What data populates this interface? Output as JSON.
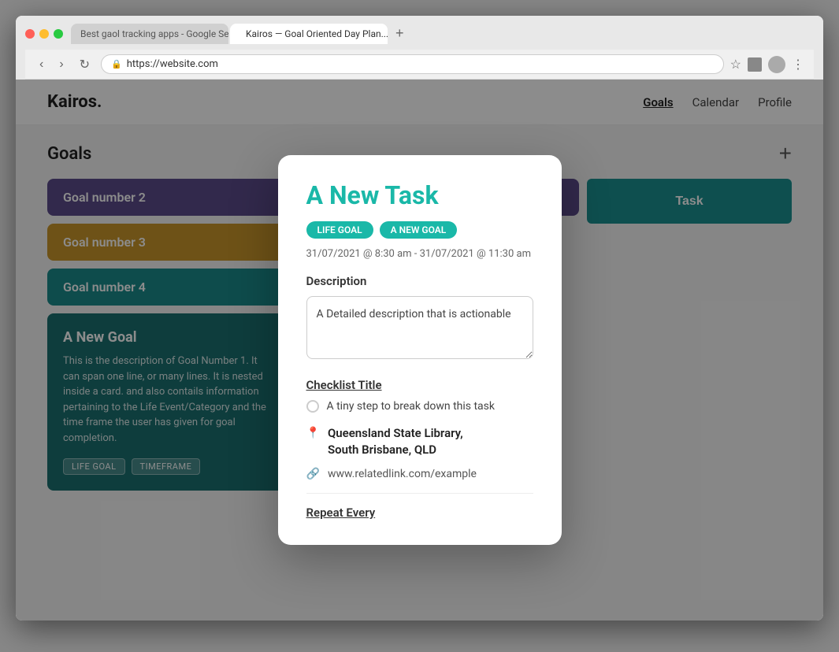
{
  "browser": {
    "tabs": [
      {
        "label": "Best gaol tracking apps - Google Sear...",
        "active": false
      },
      {
        "label": "Kairos — Goal Oriented Day Plan...",
        "active": true
      }
    ],
    "new_tab_label": "+",
    "url": "https://website.com"
  },
  "app": {
    "logo": "Kairos.",
    "nav": {
      "links": [
        {
          "label": "Goals",
          "active": true
        },
        {
          "label": "Calendar",
          "active": false
        },
        {
          "label": "Profile",
          "active": false
        }
      ]
    },
    "goals_section": {
      "title": "Goals",
      "add_button": "+",
      "goals": [
        {
          "label": "Goal number 2",
          "color": "purple"
        },
        {
          "label": "Goal number 3",
          "color": "gold"
        },
        {
          "label": "Goal number 4",
          "color": "teal"
        }
      ],
      "task_button": "Task",
      "new_goal_card": {
        "title": "A New Goal",
        "description": "This is the description of Goal Number 1. It can span one line, or many lines. It is nested inside a card. and also contails information pertaining to the Life Event/Category and the time frame the user has given for goal completion.",
        "tags": [
          "LIFE GOAL",
          "TIMEFRAME"
        ]
      }
    }
  },
  "modal": {
    "title": "A New Task",
    "tags": [
      {
        "label": "LIFE GOAL",
        "class": "life-goal"
      },
      {
        "label": "A NEW GOAL",
        "class": "new-goal"
      }
    ],
    "datetime": "31/07/2021 @ 8:30 am - 31/07/2021 @ 11:30 am",
    "description_label": "Description",
    "description_text": "A Detailed description that is actionable",
    "checklist_title": "Checklist Title",
    "checklist_items": [
      {
        "text": "A tiny step to break down this task"
      }
    ],
    "location": {
      "name": "Queensland State Library,",
      "suburb": "South Brisbane, QLD"
    },
    "link": "www.relatedlink.com/example",
    "repeat_label": "Repeat Every"
  },
  "icons": {
    "back": "‹",
    "forward": "›",
    "refresh": "↻",
    "lock": "🔒",
    "star": "☆",
    "menu": "⋮",
    "location_pin": "📍",
    "link_circle": "🔗"
  }
}
